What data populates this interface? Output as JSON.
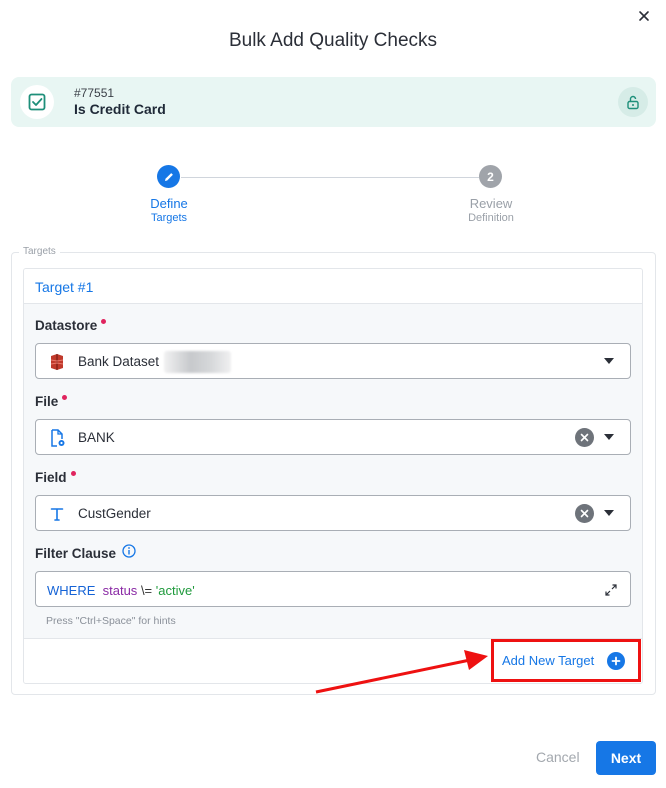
{
  "dialog": {
    "title": "Bulk Add Quality Checks"
  },
  "check": {
    "id": "#77551",
    "name": "Is Credit Card",
    "icon": "check-square-icon",
    "lock_icon": "unlock-icon"
  },
  "stepper": {
    "steps": [
      {
        "number": "1",
        "line1": "Define",
        "line2": "Targets",
        "state": "active",
        "icon": "pencil-icon"
      },
      {
        "number": "2",
        "line1": "Review",
        "line2": "Definition",
        "state": "inactive"
      }
    ]
  },
  "targets": {
    "legend": "Targets",
    "items": [
      {
        "title": "Target #1",
        "datastore": {
          "label": "Datastore",
          "required": true,
          "value": "Bank Dataset",
          "icon": "amazon-s3-icon"
        },
        "file": {
          "label": "File",
          "required": true,
          "value": "BANK",
          "icon": "file-gear-icon"
        },
        "field": {
          "label": "Field",
          "required": true,
          "value": "CustGender",
          "icon": "text-type-icon"
        },
        "filter_clause": {
          "label": "Filter Clause",
          "info_icon": "info-icon",
          "tokens": {
            "keyword": "WHERE",
            "identifier": "status",
            "operator": "\\=",
            "string": "'active'"
          },
          "hint": "Press \"Ctrl+Space\" for hints"
        }
      }
    ],
    "add_button": "Add New Target"
  },
  "footer": {
    "cancel": "Cancel",
    "next": "Next"
  },
  "colors": {
    "accent": "#1677e6",
    "required": "#e0245e",
    "highlight_border": "#ee1111",
    "card_bg": "#e8f6f3"
  }
}
